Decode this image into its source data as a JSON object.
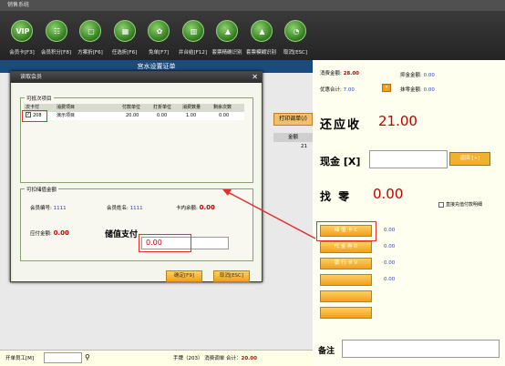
{
  "window_title": "销售系统",
  "toolbar": [
    {
      "icon": "vip-icon",
      "glyph": "VIP",
      "label": "会员卡[F3]"
    },
    {
      "icon": "member-benefit-icon",
      "glyph": "☷",
      "label": "会员积分[F8]"
    },
    {
      "icon": "plan-icon",
      "glyph": "▢",
      "label": "方案折[F6]"
    },
    {
      "icon": "discount-icon",
      "glyph": "▦",
      "label": "任选折[F6]"
    },
    {
      "icon": "free-icon",
      "glyph": "✿",
      "label": "免单[F7]"
    },
    {
      "icon": "merge-icon",
      "glyph": "▥",
      "label": "并台结[F12]"
    },
    {
      "icon": "combo-precise-icon",
      "glyph": "▲",
      "label": "套票精确识别"
    },
    {
      "icon": "combo-fuzzy-icon",
      "glyph": "▲",
      "label": "套票模糊识别"
    },
    {
      "icon": "cancel-icon",
      "glyph": "◔",
      "label": "取消[ESC]"
    }
  ],
  "main": {
    "header": "宫水设置证单",
    "print_strip": "打印调单(/)",
    "col_amount": "金额",
    "row_value": "21"
  },
  "bottom": {
    "staff_label": "开单员工[M]",
    "status": "手牌（203） 消费调单 合计：",
    "total": "20.00"
  },
  "summary": {
    "consume_label": "消费金额:",
    "consume_value": "28.00",
    "discount_label": "优惠合计:",
    "discount_value": "7.00",
    "sub_label": "抑金金额:",
    "sub_value": "0.00",
    "round_label": "抹零金额:",
    "round_value": "0.00",
    "due_label": "还应收",
    "due_value": "21.00",
    "cash_label": "现金 [X]",
    "cash_btn": "返回 [+]",
    "change_label": "找  零",
    "change_value": "0.00",
    "checkbox_label": "直接充值付款明细"
  },
  "payments": [
    {
      "label": "储 值 卡 C",
      "amount": "0.00"
    },
    {
      "label": "代 金 券 D",
      "amount": "0.00"
    },
    {
      "label": "银 行 卡 V",
      "amount": "0.00"
    },
    {
      "label": "",
      "amount": "0.00"
    },
    {
      "label": "",
      "amount": ""
    },
    {
      "label": "",
      "amount": ""
    }
  ],
  "note_label": "备注",
  "dialog": {
    "title": "读取会员",
    "group1_title": "可抵次项目",
    "headers": [
      "次卡付",
      "消费项目",
      "付款单位",
      "打折单位",
      "消费数量",
      "剩余次数"
    ],
    "row": {
      "checked": "✓",
      "code": "208",
      "item": "演示项目",
      "pay_unit": "20.00",
      "disc_unit": "0.00",
      "qty": "1.00",
      "remain": "0.00"
    },
    "group2_title": "可扣储值金额",
    "member_no_label": "会员编号:",
    "member_no": "1111",
    "member_name_label": "会员姓名:",
    "member_name": "1111",
    "card_balance_label": "卡内余额:",
    "card_balance": "0.00",
    "due_amount_label": "应付金额:",
    "due_amount": "0.00",
    "stored_pay_label": "储值支付",
    "stored_pay_value": "0.00",
    "ok_button": "确定[F9]",
    "cancel_button": "取消[ESC]"
  }
}
